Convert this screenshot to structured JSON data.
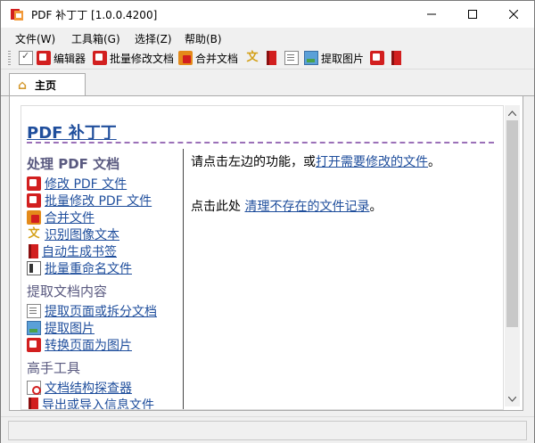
{
  "window": {
    "title": "PDF 补丁丁 [1.0.0.4200]",
    "min_glyph": "—",
    "max_glyph": "☐",
    "close_glyph": "✕"
  },
  "menu": [
    {
      "label": "文件(W)"
    },
    {
      "label": "工具箱(G)"
    },
    {
      "label": "选择(Z)"
    },
    {
      "label": "帮助(B)"
    }
  ],
  "toolbar": [
    {
      "label": "编辑器",
      "icon": "pdf-icon"
    },
    {
      "label": "批量修改文档",
      "icon": "batch-edit-icon"
    },
    {
      "label": "合并文档",
      "icon": "merge-icon"
    },
    {
      "label": "",
      "icon": "ocr-icon"
    },
    {
      "label": "",
      "icon": "bookmark-icon"
    },
    {
      "label": "",
      "icon": "extract-pages-icon"
    },
    {
      "label": "提取图片",
      "icon": "extract-images-icon"
    },
    {
      "label": "",
      "icon": "convert-image-icon"
    },
    {
      "label": "",
      "icon": "export-icon"
    }
  ],
  "tabs": [
    {
      "label": "主页",
      "icon": "home-icon"
    }
  ],
  "home": {
    "title": "PDF 补丁丁",
    "sections": [
      {
        "title": "处理 PDF 文档",
        "links": [
          "修改 PDF 文件",
          "批量修改 PDF 文件",
          "合并文件",
          "识别图像文本",
          "自动生成书签",
          "批量重命名文件"
        ]
      },
      {
        "title": "提取文档内容",
        "links": [
          "提取页面或拆分文档",
          "提取图片",
          "转换页面为图片"
        ]
      },
      {
        "title": "高手工具",
        "links": [
          "文档结构探查器",
          "导出或导入信息文件"
        ]
      }
    ],
    "main": {
      "line1_prefix": "请点击左边的功能，或",
      "line1_link": "打开需要修改的文件",
      "line1_suffix": "。",
      "line2_prefix": "点击此处 ",
      "line2_link": "清理不存在的文件记录",
      "line2_suffix": "。"
    }
  },
  "scroll": {
    "up_glyph": "▲",
    "down_glyph": "▼"
  }
}
